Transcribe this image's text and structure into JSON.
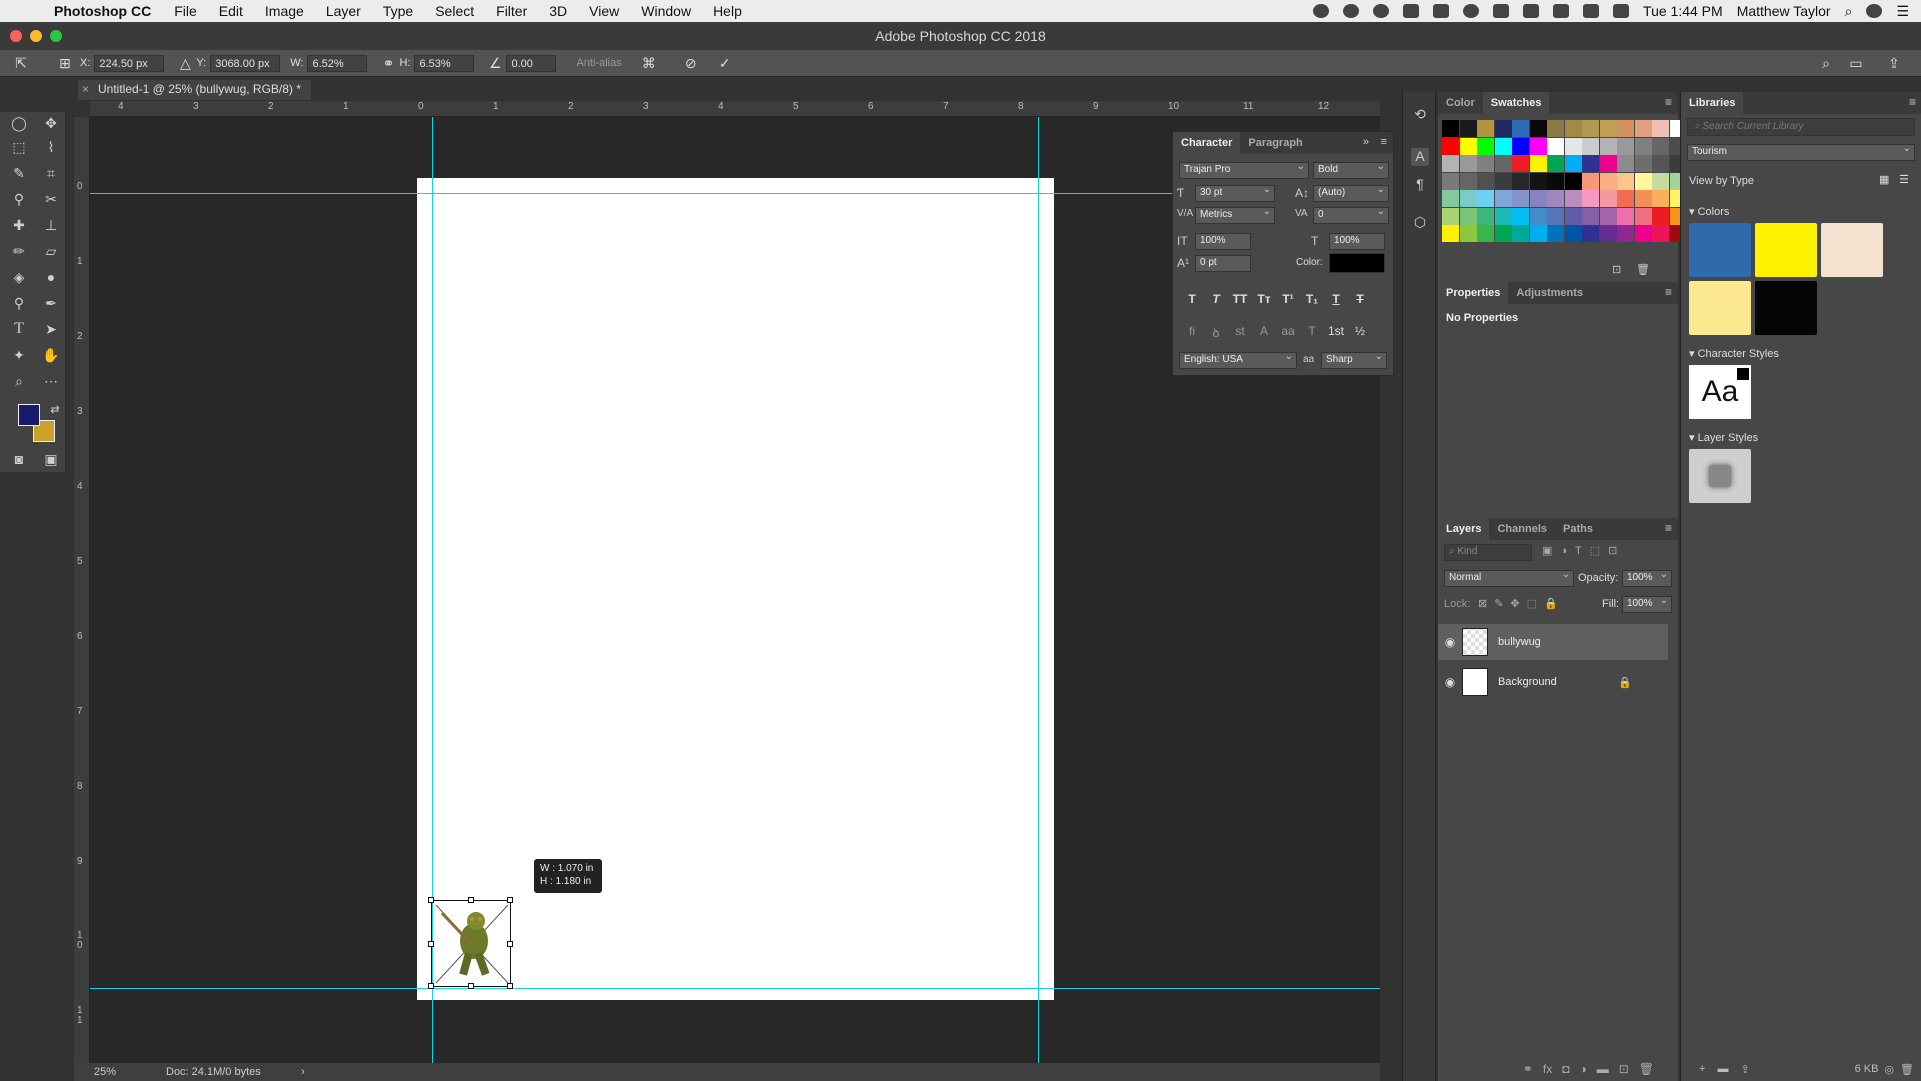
{
  "menubar": {
    "app": "Photoshop CC",
    "items": [
      "File",
      "Edit",
      "Image",
      "Layer",
      "Type",
      "Select",
      "Filter",
      "3D",
      "View",
      "Window",
      "Help"
    ],
    "clock": "Tue 1:44 PM",
    "user": "Matthew Taylor"
  },
  "window": {
    "title": "Adobe Photoshop CC 2018"
  },
  "options": {
    "x_label": "X:",
    "x_value": "224.50 px",
    "y_label": "Y:",
    "y_value": "3068.00 px",
    "w_label": "W:",
    "w_value": "6.52%",
    "h_label": "H:",
    "h_value": "6.53%",
    "angle_value": "0.00",
    "antialias": "Anti-alias"
  },
  "document": {
    "tab_title": "Untitled-1 @ 25% (bullywug, RGB/8) *"
  },
  "ruler": {
    "top": [
      "4",
      "3",
      "2",
      "1",
      "0",
      "1",
      "2",
      "3",
      "4",
      "5",
      "6",
      "7",
      "8",
      "9",
      "10",
      "11",
      "12"
    ],
    "left": [
      "0",
      "1",
      "2",
      "3",
      "4",
      "5",
      "6",
      "7",
      "8",
      "9",
      "1 0",
      "1 1"
    ]
  },
  "transform_tooltip": {
    "w": "W : 1.070 in",
    "h": "H : 1.180 in"
  },
  "status": {
    "zoom": "25%",
    "doc": "Doc: 24.1M/0 bytes"
  },
  "character": {
    "tabs": [
      "Character",
      "Paragraph"
    ],
    "font": "Trajan Pro",
    "style": "Bold",
    "size": "30 pt",
    "leading": "(Auto)",
    "kerning": "Metrics",
    "tracking": "0",
    "vscale": "100%",
    "hscale": "100%",
    "baseline": "0 pt",
    "color_label": "Color:",
    "language": "English: USA",
    "aa_method": "Sharp"
  },
  "color_panel": {
    "tabs": [
      "Color",
      "Swatches"
    ]
  },
  "properties": {
    "tabs": [
      "Properties",
      "Adjustments"
    ],
    "empty": "No Properties"
  },
  "layers": {
    "tabs": [
      "Layers",
      "Channels",
      "Paths"
    ],
    "kind_placeholder": "Kind",
    "blend": "Normal",
    "opacity_label": "Opacity:",
    "opacity": "100%",
    "lock_label": "Lock:",
    "fill_label": "Fill:",
    "fill": "100%",
    "items": [
      {
        "name": "bullywug"
      },
      {
        "name": "Background"
      }
    ]
  },
  "libraries": {
    "title": "Libraries",
    "search_placeholder": "Search Current Library",
    "library": "Tourism",
    "view_by": "View by Type",
    "colors_heading": "Colors",
    "char_styles_heading": "Character Styles",
    "char_style_sample": "Aa",
    "layer_styles_heading": "Layer Styles",
    "size": "6 KB"
  },
  "colors": {
    "fg": "#1a1a6b",
    "bg": "#c9a227",
    "guide": "#19d1e1",
    "lib_swatches": [
      "#2f6aad",
      "#fff200",
      "#f5e1d0",
      "#fce98f",
      "#050505"
    ]
  },
  "swatches": {
    "rows": [
      [
        "#000000",
        "#1a1a1a",
        "#b39440",
        "#1f2a63",
        "#2e6bb5",
        "#0a0a0a",
        "#8c7a45",
        "#a08b45",
        "#b09850",
        "#c0a050",
        "#d09060",
        "#e0a080",
        "#f0c0b0",
        "#ffffff"
      ],
      [
        "#ff0000",
        "#ffff00",
        "#00ff00",
        "#00ffff",
        "#0000ff",
        "#ff00ff",
        "#ffffff",
        "#e6e6e6",
        "#cccccc",
        "#b3b3b3",
        "#999999",
        "#808080",
        "#666666",
        "#4d4d4d"
      ],
      [
        "#b3b3b3",
        "#999999",
        "#808080",
        "#666666",
        "#ee1c24",
        "#fff200",
        "#00a651",
        "#00aeef",
        "#2e3192",
        "#ec008c",
        "#8b8b8b",
        "#6e6e6e",
        "#555555",
        "#3c3c3c"
      ],
      [
        "#7a7a7a",
        "#656565",
        "#505050",
        "#3c3c3c",
        "#282828",
        "#141414",
        "#0a0a0a",
        "#000000",
        "#f7977a",
        "#fbad82",
        "#fdc68c",
        "#fff79a",
        "#c4df9b",
        "#a3d39c"
      ],
      [
        "#82ca9c",
        "#7accc8",
        "#6dcff6",
        "#7da7d8",
        "#8493ca",
        "#8882be",
        "#a187be",
        "#bc8dbf",
        "#f49ac2",
        "#f6989d",
        "#f26c4f",
        "#f68e55",
        "#fbaf5a",
        "#fff467"
      ],
      [
        "#acd373",
        "#7cc576",
        "#3bb878",
        "#1abbb4",
        "#00bff3",
        "#438ccb",
        "#5574b9",
        "#605ca8",
        "#855fa8",
        "#a763a9",
        "#f06eaa",
        "#f26d7d",
        "#ed1c24",
        "#f7941d"
      ],
      [
        "#fff200",
        "#8dc63f",
        "#39b54a",
        "#00a651",
        "#00a99d",
        "#00aeef",
        "#0072bc",
        "#0054a6",
        "#2e3192",
        "#662d91",
        "#92278f",
        "#ec008c",
        "#ed145b",
        "#9e0b0f"
      ]
    ]
  },
  "icons": [
    "apple-icon",
    "search-icon",
    "spotlight-icon",
    "eye-icon",
    "lock-icon",
    "checkmark-icon",
    "cancel-icon",
    "menu-icon",
    "grid-icon",
    "list-icon"
  ]
}
